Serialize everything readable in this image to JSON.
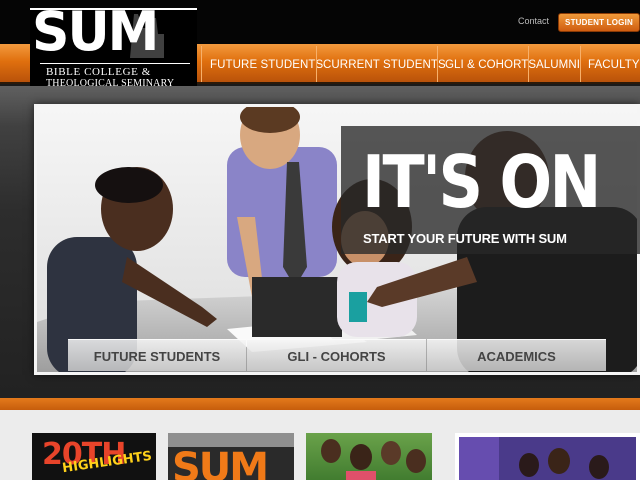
{
  "header": {
    "contact_link": "Contact",
    "login_button": "STUDENT LOGIN",
    "logo": {
      "wordmark": "SUM",
      "line1": "BIBLE COLLEGE &",
      "line2": "THEOLOGICAL SEMINARY"
    }
  },
  "nav": {
    "items": [
      "FUTURE STUDENTS",
      "CURRENT STUDENTS",
      "GLI & COHORTS",
      "ALUMNI",
      "FACULTY"
    ]
  },
  "hero": {
    "headline": "IT'S ON",
    "tagline": "START YOUR FUTURE WITH SUM",
    "buttons": [
      "FUTURE STUDENTS",
      "GLI - COHORTS",
      "ACADEMICS"
    ]
  },
  "thumbnails": {
    "highlights": {
      "line1": "20TH",
      "line2": "HIGHLIGHTS"
    },
    "sum_logo": "SUM"
  },
  "colors": {
    "accent": "#e0700e",
    "topbar": "#050505",
    "button_text": "#444444"
  }
}
